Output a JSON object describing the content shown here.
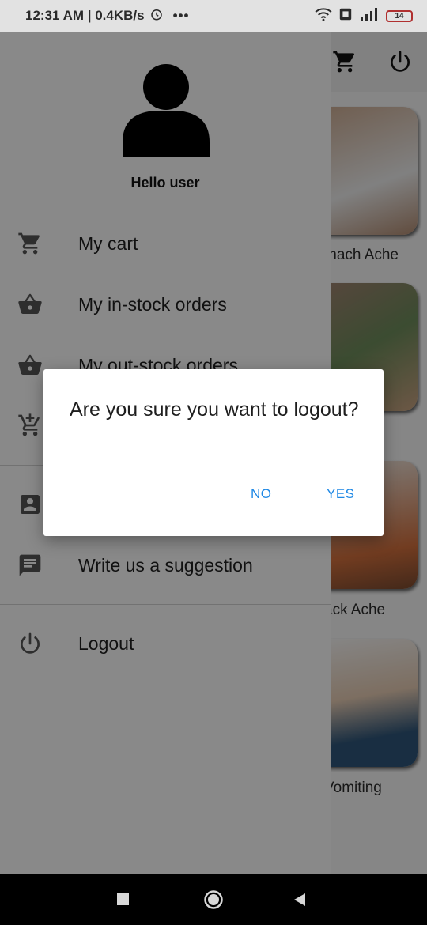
{
  "status_bar": {
    "time": "12:31 AM | 0.4KB/s",
    "more": "•••",
    "battery": "14"
  },
  "background": {
    "cards": [
      {
        "label": "mach Ache"
      },
      {
        "label": ""
      },
      {
        "label": "ack Ache"
      },
      {
        "label": "Vomiting"
      }
    ]
  },
  "drawer": {
    "greeting": "Hello user",
    "items": [
      {
        "label": "My cart",
        "icon": "cart-icon"
      },
      {
        "label": "My in-stock orders",
        "icon": "basket-icon"
      },
      {
        "label": "My out-stock orders",
        "icon": "basket-icon"
      },
      {
        "label": "",
        "icon": "add-cart-icon"
      },
      {
        "label": "",
        "icon": "contact-icon"
      },
      {
        "label": "Write us a suggestion",
        "icon": "message-icon"
      },
      {
        "label": "Logout",
        "icon": "power-icon"
      }
    ]
  },
  "dialog": {
    "title": "Are you sure you want to logout?",
    "no_label": "NO",
    "yes_label": "YES",
    "accent": "#1e88e5"
  }
}
